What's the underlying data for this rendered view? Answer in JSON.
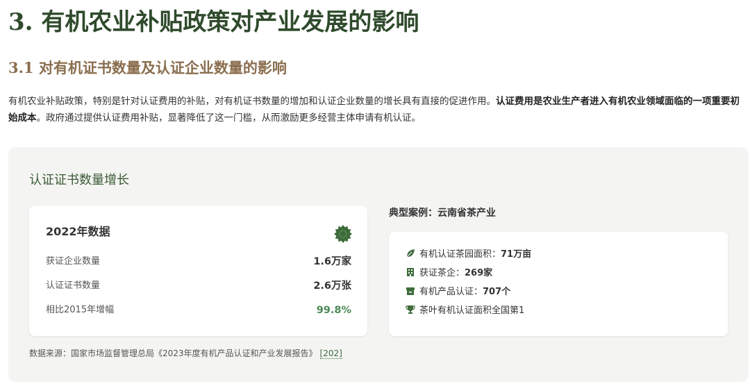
{
  "heading": "3. 有机农业补贴政策对产业发展的影响",
  "subheading": "3.1 对有机证书数量及认证企业数量的影响",
  "intro": {
    "part1": "有机农业补贴政策，特别是针对认证费用的补贴，对有机证书数量的增加和认证企业数量的增长具有直接的促进作用。",
    "bold": "认证费用是农业生产者进入有机农业领域面临的一项重要初始成本",
    "part2": "。政府通过提供认证费用补贴，显著降低了这一门槛，从而激励更多经营主体申请有机认证。"
  },
  "panel": {
    "title": "认证证书数量增长",
    "data_card": {
      "title": "2022年数据",
      "badge_icon": "seal-badge-icon",
      "rows": [
        {
          "label": "获证企业数量",
          "value": "1.6万家"
        },
        {
          "label": "认证证书数量",
          "value": "2.6万张"
        },
        {
          "label": "相比2015年增幅",
          "value": "99.8%"
        }
      ]
    },
    "case": {
      "title": "典型案例：云南省茶产业",
      "items": [
        {
          "icon": "leaf-icon",
          "label": "有机认证茶园面积：",
          "value": "71万亩"
        },
        {
          "icon": "building-icon",
          "label": "获证茶企：",
          "value": "269家"
        },
        {
          "icon": "package-icon",
          "label": "有机产品认证：",
          "value": "707个"
        },
        {
          "icon": "trophy-icon",
          "label": "茶叶有机认证面积全国第1",
          "value": ""
        }
      ]
    },
    "source": {
      "text": "数据来源：国家市场监督管理总局《2023年度有机产品认证和产业发展报告》",
      "ref": "[202]"
    }
  },
  "colors": {
    "heading": "#2f4a2c",
    "subheading": "#8a6e4e",
    "accent_green": "#4c8a56",
    "panel_bg": "#f4f5f2"
  }
}
